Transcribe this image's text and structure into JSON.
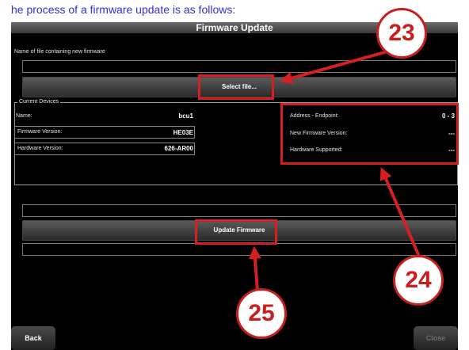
{
  "caption": "he process of a firmware update is as follows:",
  "window": {
    "title": "Firmware Update"
  },
  "file": {
    "label": "Name of file containing new firmware",
    "path": "",
    "select_label": "Select file..."
  },
  "devices": {
    "legend": "Current Devices",
    "name_label": "Name:",
    "name_value": "bcu1",
    "fw_label": "Firmware Version:",
    "fw_value": "HE03E",
    "hw_label": "Hardware Version:",
    "hw_value": "626-AR00",
    "addr_label": "Address - Endpoint:",
    "addr_value": "0 - 3",
    "newfw_label": "New Firmware Version:",
    "newfw_value": "---",
    "hwsupp_label": "Hardware Supported:",
    "hwsupp_value": "---"
  },
  "update": {
    "label": "Update Firmware",
    "status": ""
  },
  "footer": {
    "back": "Back",
    "close": "Close"
  },
  "callouts": [
    "23",
    "24",
    "25"
  ],
  "colors": {
    "highlight": "#d42020",
    "caption": "#2f2fd8"
  }
}
